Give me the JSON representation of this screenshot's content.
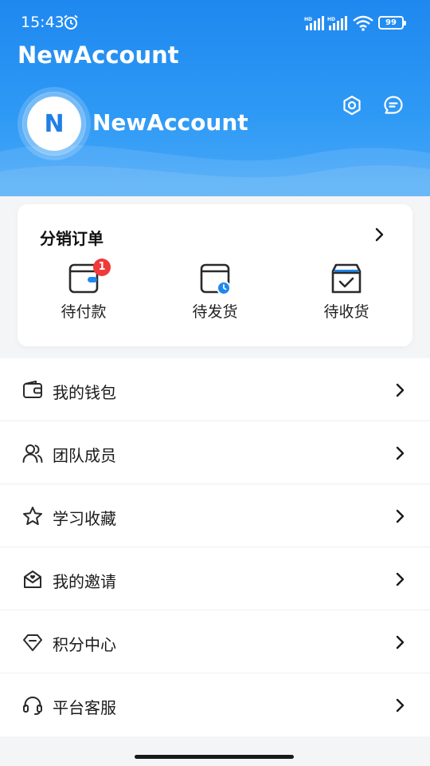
{
  "status_bar": {
    "time": "15:43",
    "battery": "99",
    "icons": [
      "alarm-icon",
      "signal-hd-icon",
      "signal-hd-icon",
      "wifi-icon",
      "battery-icon"
    ]
  },
  "header": {
    "app_title": "NewAccount",
    "avatar_initial": "N",
    "profile_name": "NewAccount",
    "actions": [
      "settings-icon",
      "message-icon"
    ],
    "gradient_colors": [
      "#1e88f0",
      "#4aa9f7"
    ]
  },
  "orders_card": {
    "title": "分销订单",
    "items": [
      {
        "label": "待付款",
        "icon": "wallet-icon",
        "badge": "1"
      },
      {
        "label": "待发货",
        "icon": "pending-ship-icon",
        "badge": ""
      },
      {
        "label": "待收货",
        "icon": "receive-box-icon",
        "badge": ""
      }
    ]
  },
  "menu": {
    "items": [
      {
        "label": "我的钱包",
        "icon": "wallet-icon"
      },
      {
        "label": "团队成员",
        "icon": "team-icon"
      },
      {
        "label": "学习收藏",
        "icon": "star-icon"
      },
      {
        "label": "我的邀请",
        "icon": "invite-mail-icon"
      },
      {
        "label": "积分中心",
        "icon": "diamond-icon"
      },
      {
        "label": "平台客服",
        "icon": "headset-icon"
      }
    ]
  },
  "colors": {
    "accent": "#1e88f0",
    "badge": "#f0393a",
    "page_bg": "#f4f5f7"
  }
}
